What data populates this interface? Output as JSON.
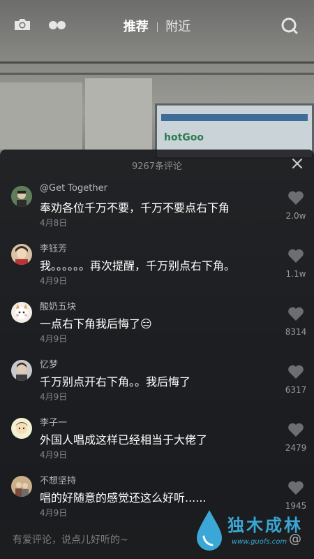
{
  "header": {
    "tab_recommend": "推荐",
    "tab_nearby": "附近",
    "icons": [
      "camera-icon",
      "dual-dot-icon",
      "search-icon"
    ]
  },
  "panel": {
    "comment_count": "9267条评论",
    "close_icon": "close-icon"
  },
  "comments": [
    {
      "user": "@Get Together",
      "text": "奉劝各位千万不要，千万不要点右下角",
      "date": "4月8日",
      "likes": "2.0w"
    },
    {
      "user": "李钰芳",
      "text": "我。。。。。。再次提醒，千万别点右下角。",
      "date": "4月9日",
      "likes": "1.1w"
    },
    {
      "user": "酸奶五块",
      "text": "一点右下角我后悔了😑",
      "date": "4月9日",
      "likes": "8314"
    },
    {
      "user": "忆梦",
      "text": "千万别点开右下角。。我后悔了",
      "date": "4月9日",
      "likes": "6317"
    },
    {
      "user": "李子一",
      "text": "外国人唱成这样已经相当于大佬了",
      "date": "4月9日",
      "likes": "2479"
    },
    {
      "user": "不想坚持",
      "text": "唱的好随意的感觉还这么好听......",
      "date": "4月9日",
      "likes": "1945"
    }
  ],
  "input": {
    "placeholder": "有爱评论，说点儿好听的~",
    "at_label": "@"
  },
  "watermark": {
    "title": "独木成林",
    "url": "www.guofs.com"
  },
  "colors": {
    "panel_bg": "#16171a",
    "text_primary": "#ffffff",
    "text_secondary": "#85868a",
    "watermark": "#3aa7d6"
  }
}
